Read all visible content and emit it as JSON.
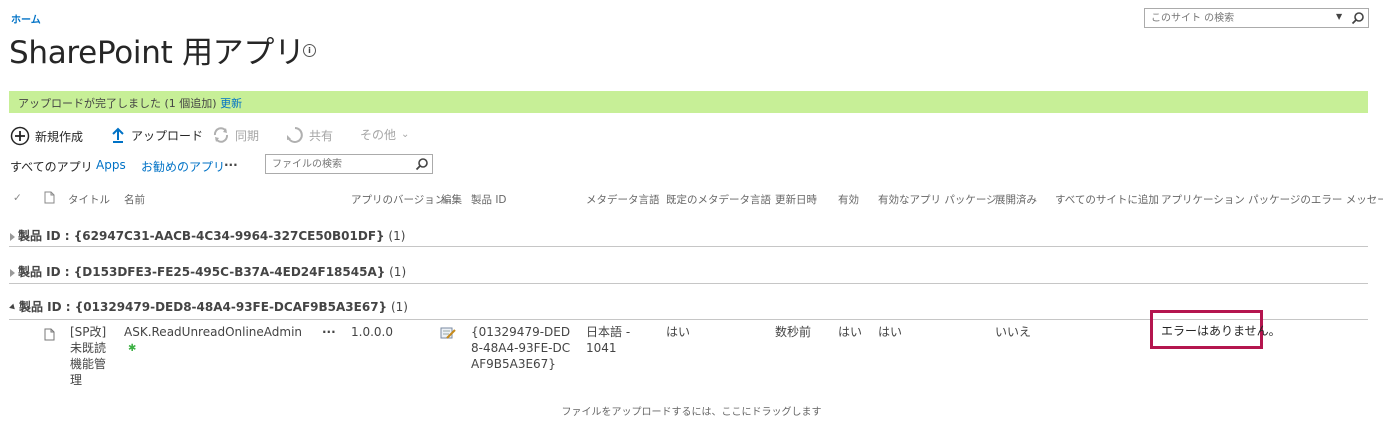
{
  "breadcrumb": {
    "home": "ホーム"
  },
  "page": {
    "title": "SharePoint 用アプリ",
    "info_icon": "info-circle-icon"
  },
  "site_search": {
    "placeholder": "このサイト の検索",
    "scope_icon": "chevron-down-icon",
    "button_icon": "search-icon"
  },
  "status": {
    "message": "アップロードが完了しました (1 個追加) ",
    "link": "更新",
    "color": "#c7ef97"
  },
  "toolbar": {
    "new": "新規作成",
    "upload": "アップロード",
    "sync": "同期",
    "share": "共有",
    "more": "その他"
  },
  "views": {
    "all": "すべてのアプリ",
    "apps": "Apps",
    "recommended": "お勧めのアプリ",
    "more": "···",
    "search_placeholder": "ファイルの検索"
  },
  "columns": {
    "check": "✓",
    "type": "",
    "title": "タイトル",
    "name": "名前",
    "version": "アプリのバージョン",
    "edit": "編集",
    "product_id": "製品 ID",
    "metadata_lang": "メタデータ言語",
    "default_metadata_lang": "既定のメタデータ言語",
    "modified": "更新日時",
    "enabled": "有効",
    "valid_package": "有効なアプリ パッケージ",
    "deployed": "展開済み",
    "add_all_sites": "すべてのサイトに追加",
    "error_message": "アプリケーション パッケージのエラー メッセージ"
  },
  "groups": [
    {
      "label": "製品 ID : ",
      "id": "{62947C31-AACB-4C34-9964-327CE50B01DF}",
      "count": "(1)",
      "expanded": false
    },
    {
      "label": "製品 ID : ",
      "id": "{D153DFE3-FE25-495C-B37A-4ED24F18545A}",
      "count": "(1)",
      "expanded": false
    },
    {
      "label": "製品 ID : ",
      "id": "{01329479-DED8-48A4-93FE-DCAF9B5A3E67}",
      "count": "(1)",
      "expanded": true
    }
  ],
  "row": {
    "title": "[SP改]未既読機能管理",
    "name": "ASK.ReadUnreadOnlineAdmin",
    "new_badge": "✱",
    "menu": "···",
    "version": "1.0.0.0",
    "product_id": "{01329479-DED8-48A4-93FE-DCAF9B5A3E67}",
    "metadata_lang": "日本語 - 1041",
    "default_metadata_lang": "はい",
    "modified": "数秒前",
    "enabled": "はい",
    "valid_package": "はい",
    "deployed": "いいえ",
    "add_all_sites": "",
    "error_message": "エラーはありません。"
  },
  "drop_hint": "ファイルをアップロードするには、ここにドラッグします",
  "colors": {
    "link": "#0072c6",
    "highlight": "#b4154e"
  }
}
